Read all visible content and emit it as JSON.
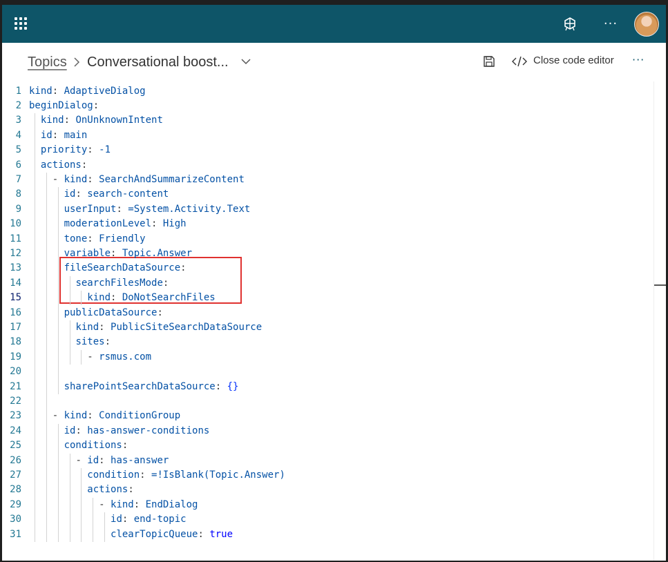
{
  "header": {
    "breadcrumb_root": "Topics",
    "topic_title": "Conversational boost...",
    "close_code_editor": "Close code editor"
  },
  "icons": {
    "app_launcher": "waffle-icon",
    "copilot": "copilot-icon",
    "more": "more-icon",
    "save": "save-icon",
    "code": "code-icon",
    "chevron": "chevron-down-icon"
  },
  "colors": {
    "appbar": "#0e5568",
    "highlight": "#e0312f",
    "key": "#0451a5",
    "line_number": "#237893"
  },
  "editor": {
    "active_line": 15,
    "lines": [
      {
        "n": "1",
        "indent": 0,
        "key": "kind",
        "sep": ": ",
        "value": "AdaptiveDialog"
      },
      {
        "n": "2",
        "indent": 0,
        "key": "beginDialog",
        "sep": ":",
        "value": ""
      },
      {
        "n": "3",
        "indent": 2,
        "key": "kind",
        "sep": ": ",
        "value": "OnUnknownIntent"
      },
      {
        "n": "4",
        "indent": 2,
        "key": "id",
        "sep": ": ",
        "value": "main"
      },
      {
        "n": "5",
        "indent": 2,
        "key": "priority",
        "sep": ": ",
        "value": "-1"
      },
      {
        "n": "6",
        "indent": 2,
        "key": "actions",
        "sep": ":",
        "value": ""
      },
      {
        "n": "7",
        "indent": 4,
        "dash": "- ",
        "key": "kind",
        "sep": ": ",
        "value": "SearchAndSummarizeContent"
      },
      {
        "n": "8",
        "indent": 6,
        "key": "id",
        "sep": ": ",
        "value": "search-content"
      },
      {
        "n": "9",
        "indent": 6,
        "key": "userInput",
        "sep": ": ",
        "value": "=System.Activity.Text"
      },
      {
        "n": "10",
        "indent": 6,
        "key": "moderationLevel",
        "sep": ": ",
        "value": "High"
      },
      {
        "n": "11",
        "indent": 6,
        "key": "tone",
        "sep": ": ",
        "value": "Friendly"
      },
      {
        "n": "12",
        "indent": 6,
        "key": "variable",
        "sep": ": ",
        "value": "Topic.Answer"
      },
      {
        "n": "13",
        "indent": 6,
        "key": "fileSearchDataSource",
        "sep": ":",
        "value": ""
      },
      {
        "n": "14",
        "indent": 8,
        "key": "searchFilesMode",
        "sep": ":",
        "value": ""
      },
      {
        "n": "15",
        "indent": 10,
        "key": "kind",
        "sep": ": ",
        "value": "DoNotSearchFiles"
      },
      {
        "n": "16",
        "indent": 6,
        "key": "publicDataSource",
        "sep": ":",
        "value": ""
      },
      {
        "n": "17",
        "indent": 8,
        "key": "kind",
        "sep": ": ",
        "value": "PublicSiteSearchDataSource"
      },
      {
        "n": "18",
        "indent": 8,
        "key": "sites",
        "sep": ":",
        "value": ""
      },
      {
        "n": "19",
        "indent": 10,
        "dash": "- ",
        "key": "",
        "sep": "",
        "value": "rsmus.com"
      },
      {
        "n": "20",
        "indent": 0,
        "key": "",
        "sep": "",
        "value": ""
      },
      {
        "n": "21",
        "indent": 6,
        "key": "sharePointSearchDataSource",
        "sep": ": ",
        "value": "{}"
      },
      {
        "n": "22",
        "indent": 0,
        "key": "",
        "sep": "",
        "value": ""
      },
      {
        "n": "23",
        "indent": 4,
        "dash": "- ",
        "key": "kind",
        "sep": ": ",
        "value": "ConditionGroup"
      },
      {
        "n": "24",
        "indent": 6,
        "key": "id",
        "sep": ": ",
        "value": "has-answer-conditions"
      },
      {
        "n": "25",
        "indent": 6,
        "key": "conditions",
        "sep": ":",
        "value": ""
      },
      {
        "n": "26",
        "indent": 8,
        "dash": "- ",
        "key": "id",
        "sep": ": ",
        "value": "has-answer"
      },
      {
        "n": "27",
        "indent": 10,
        "key": "condition",
        "sep": ": ",
        "value": "=!IsBlank(Topic.Answer)"
      },
      {
        "n": "28",
        "indent": 10,
        "key": "actions",
        "sep": ":",
        "value": ""
      },
      {
        "n": "29",
        "indent": 12,
        "dash": "- ",
        "key": "kind",
        "sep": ": ",
        "value": "EndDialog"
      },
      {
        "n": "30",
        "indent": 14,
        "key": "id",
        "sep": ": ",
        "value": "end-topic"
      },
      {
        "n": "31",
        "indent": 14,
        "key": "clearTopicQueue",
        "sep": ": ",
        "value": "true"
      }
    ]
  }
}
